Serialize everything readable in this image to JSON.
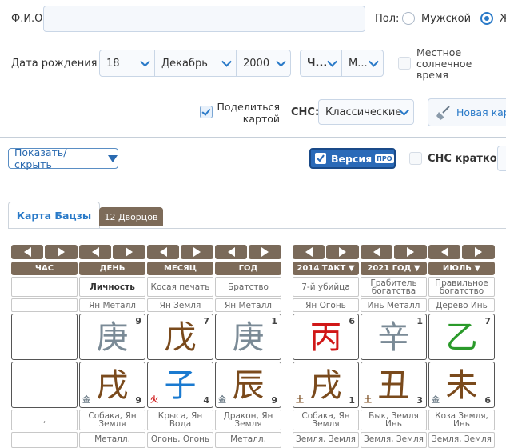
{
  "form": {
    "fio_label": "Ф.И.О.",
    "fio_value": "",
    "gender_label": "Пол:",
    "gender_male": "Мужской",
    "gender_female": "Ж",
    "birth_label": "Дата рождения",
    "day": "18",
    "month": "Декабрь",
    "year": "2000",
    "hour": "Ч...",
    "minute": "М...",
    "local_time_label": "Местное солнечное время",
    "share_label": "Поделиться картой",
    "sns_label": "СНС:",
    "sns_value": "Классические",
    "new_card_label": "Новая карт"
  },
  "toolbar": {
    "show_hide": "Показать/скрыть",
    "version_label": "Версия",
    "version_badge": "ПРО",
    "sns_short": "СНС кратко"
  },
  "tabs": [
    "Карта Бацзы",
    "12 Дворцов"
  ],
  "pillars": {
    "headers": [
      "ЧАС",
      "ДЕНЬ",
      "МЕСЯЦ",
      "ГОД"
    ],
    "row_gods": [
      "",
      "Личность",
      "Косая печать",
      "Братство"
    ],
    "row_elements": [
      "",
      "Ян Металл",
      "Ян Земля",
      "Ян Металл"
    ],
    "stems": [
      {
        "glyph": "",
        "num": "",
        "color": "#000000"
      },
      {
        "glyph": "庚",
        "num": "9",
        "color": "#7a8a96"
      },
      {
        "glyph": "戊",
        "num": "7",
        "color": "#7a4a1c"
      },
      {
        "glyph": "庚",
        "num": "1",
        "color": "#7a8a96"
      }
    ],
    "branches": [
      {
        "glyph": "",
        "num": "",
        "elem": "",
        "color": "#000000",
        "elem_color": "#000000"
      },
      {
        "glyph": "戌",
        "num": "9",
        "elem": "金",
        "color": "#7a4a1c",
        "elem_color": "#6a7a86"
      },
      {
        "glyph": "子",
        "num": "4",
        "elem": "火",
        "color": "#1a7ad0",
        "elem_color": "#d02020"
      },
      {
        "glyph": "辰",
        "num": "9",
        "elem": "金",
        "color": "#7a4a1c",
        "elem_color": "#6a7a86"
      }
    ],
    "branch_names": [
      ",",
      "Собака, Ян Земля",
      "Крыса, Ян Вода",
      "Дракон, Ян Земля"
    ],
    "bottom": [
      "",
      "Металл,",
      "Огонь, Огонь",
      "Металл,"
    ]
  },
  "luck": {
    "headers": [
      "2014 ТАКТ",
      "2021 ГОД",
      "ИЮЛЬ"
    ],
    "row_gods": [
      "7-й убийца",
      "Грабитель богатства",
      "Правильное богатство"
    ],
    "row_elements": [
      "Ян Огонь",
      "Инь Металл",
      "Дерево Инь"
    ],
    "stems": [
      {
        "glyph": "丙",
        "num": "6",
        "color": "#d01818"
      },
      {
        "glyph": "辛",
        "num": "1",
        "color": "#7a8a96"
      },
      {
        "glyph": "乙",
        "num": "7",
        "color": "#2a9a2a"
      }
    ],
    "branches": [
      {
        "glyph": "戌",
        "num": "1",
        "elem": "土",
        "color": "#7a4a1c",
        "elem_color": "#7a4a1c"
      },
      {
        "glyph": "丑",
        "num": "3",
        "elem": "土",
        "color": "#7a4a1c",
        "elem_color": "#7a4a1c"
      },
      {
        "glyph": "未",
        "num": "6",
        "elem": "金",
        "color": "#7a4a1c",
        "elem_color": "#6a7a86"
      }
    ],
    "branch_names": [
      "Собака, Ян Земля",
      "Бык, Земля Инь",
      "Коза Земля, Инь"
    ],
    "bottom": [
      "Земля, Земля",
      "Земля, Земля",
      "Земля, Земля"
    ]
  }
}
